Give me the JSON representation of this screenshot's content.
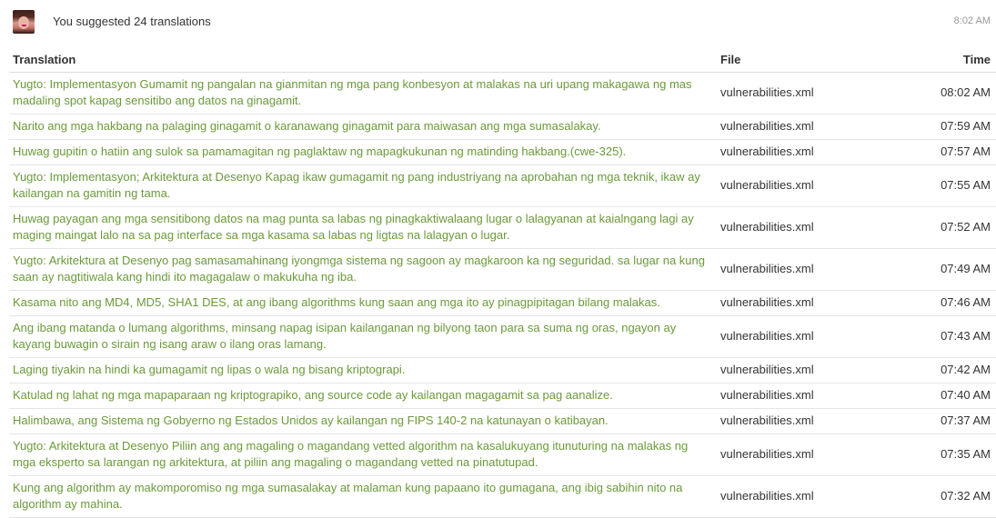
{
  "header": {
    "summary": "You suggested 24 translations",
    "time": "8:02 AM"
  },
  "table": {
    "columns": {
      "translation": "Translation",
      "file": "File",
      "time": "Time"
    },
    "rows": [
      {
        "translation": "Yugto: Implementasyon Gumamit ng pangalan na gianmitan ng mga pang konbesyon at malakas na uri upang makagawa ng mas madaling spot kapag sensitibo ang datos na ginagamit.",
        "file": "vulnerabilities.xml",
        "time": "08:02 AM"
      },
      {
        "translation": "Narito ang mga hakbang na palaging ginagamit o karanawang ginagamit para maiwasan ang mga sumasalakay.",
        "file": "vulnerabilities.xml",
        "time": "07:59 AM"
      },
      {
        "translation": "Huwag gupitin o hatiin ang sulok sa pamamagitan ng paglaktaw ng mapagkukunan ng matinding hakbang.(cwe-325).",
        "file": "vulnerabilities.xml",
        "time": "07:57 AM"
      },
      {
        "translation": "Yugto: Implementasyon; Arkitektura at Desenyo Kapag ikaw gumagamit ng pang industriyang na aprobahan ng mga teknik, ikaw ay kailangan na gamitin ng tama.",
        "file": "vulnerabilities.xml",
        "time": "07:55 AM"
      },
      {
        "translation": "Huwag payagan ang mga sensitibong datos na mag punta sa labas ng pinagkaktiwalaang lugar o lalagyanan at kaialngang lagi ay maging maingat lalo na sa pag interface sa mga kasama sa labas ng ligtas na lalagyan o lugar.",
        "file": "vulnerabilities.xml",
        "time": "07:52 AM"
      },
      {
        "translation": "Yugto: Arkitektura at Desenyo pag samasamahinang iyongmga sistema ng sagoon ay magkaroon ka ng seguridad. sa lugar na kung saan ay nagtitiwala kang hindi ito magagalaw o makukuha ng iba.",
        "file": "vulnerabilities.xml",
        "time": "07:49 AM"
      },
      {
        "translation": "Kasama nito ang MD4, MD5, SHA1 DES, at ang ibang algorithms kung saan ang mga ito ay pinagpipitagan bilang malakas.",
        "file": "vulnerabilities.xml",
        "time": "07:46 AM"
      },
      {
        "translation": "Ang ibang matanda o lumang algorithms, minsang napag isipan kailanganan ng bilyong taon para sa suma ng oras, ngayon ay kayang buwagin o sirain ng isang araw o ilang oras lamang.",
        "file": "vulnerabilities.xml",
        "time": "07:43 AM"
      },
      {
        "translation": "Laging tiyakin na hindi ka gumagamit ng lipas o wala ng bisang kriptograpi.",
        "file": "vulnerabilities.xml",
        "time": "07:42 AM"
      },
      {
        "translation": "Katulad ng lahat ng mga mapaparaan ng kriptograpiko, ang source code ay kailangan magagamit sa pag aanalize.",
        "file": "vulnerabilities.xml",
        "time": "07:40 AM"
      },
      {
        "translation": "Halimbawa, ang Sistema ng Gobyerno ng Estados Unidos ay kailangan ng FIPS 140-2 na katunayan o katibayan.",
        "file": "vulnerabilities.xml",
        "time": "07:37 AM"
      },
      {
        "translation": "Yugto: Arkitektura at Desenyo Piliin ang ang magaling o magandang vetted algorithm na kasalukuyang itunuturing na malakas ng mga eksperto sa larangan ng arkitektura, at piliin ang magaling o magandang vetted na pinatutupad.",
        "file": "vulnerabilities.xml",
        "time": "07:35 AM"
      },
      {
        "translation": "Kung ang algorithm ay makomporomiso ng mga sumasalakay at malaman kung papaano ito gumagana, ang ibig sabihin nito na algorithm ay mahina.",
        "file": "vulnerabilities.xml",
        "time": "07:32 AM"
      }
    ]
  },
  "colors": {
    "translation_text": "#6b9a3a",
    "muted": "#999999"
  }
}
